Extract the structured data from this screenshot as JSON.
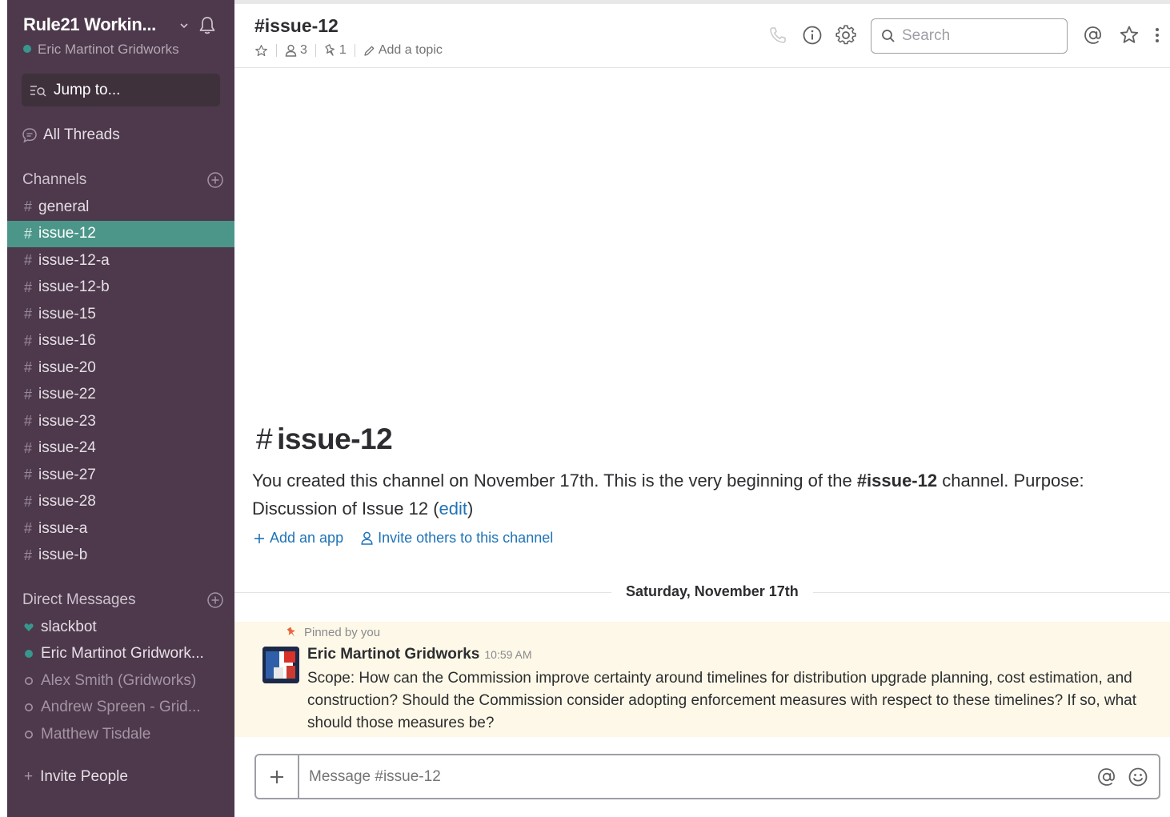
{
  "window": {
    "accent": "#4c9689",
    "sidebar_bg": "#4d394b"
  },
  "sidebar": {
    "team_name": "Rule21 Workin...",
    "current_user": "Eric Martinot Gridworks",
    "jump_to": "Jump to...",
    "all_threads": "All Threads",
    "channels_heading": "Channels",
    "channels": [
      {
        "name": "general",
        "active": false
      },
      {
        "name": "issue-12",
        "active": true
      },
      {
        "name": "issue-12-a",
        "active": false
      },
      {
        "name": "issue-12-b",
        "active": false
      },
      {
        "name": "issue-15",
        "active": false
      },
      {
        "name": "issue-16",
        "active": false
      },
      {
        "name": "issue-20",
        "active": false
      },
      {
        "name": "issue-22",
        "active": false
      },
      {
        "name": "issue-23",
        "active": false
      },
      {
        "name": "issue-24",
        "active": false
      },
      {
        "name": "issue-27",
        "active": false
      },
      {
        "name": "issue-28",
        "active": false
      },
      {
        "name": "issue-a",
        "active": false
      },
      {
        "name": "issue-b",
        "active": false
      }
    ],
    "dm_heading": "Direct Messages",
    "direct_messages": [
      {
        "name": "slackbot",
        "status": "heart"
      },
      {
        "name": "Eric Martinot Gridwork...",
        "status": "online"
      },
      {
        "name": "Alex Smith (Gridworks)",
        "status": "away"
      },
      {
        "name": "Andrew Spreen - Grid...",
        "status": "away"
      },
      {
        "name": "Matthew Tisdale",
        "status": "away"
      }
    ],
    "invite_people": "Invite People"
  },
  "header": {
    "channel_title": "#issue-12",
    "member_count": "3",
    "pinned_count": "1",
    "add_topic": "Add a topic",
    "search_placeholder": "Search"
  },
  "intro": {
    "hash": "#",
    "title": "issue-12",
    "text_before": "You created this channel on November 17th. This is the very beginning of the ",
    "channel_ref": "#issue-12",
    "text_after": " channel. Purpose: Discussion of Issue 12 (",
    "edit_link": "edit",
    "text_close": ")",
    "add_app": "Add an app",
    "invite_others": "Invite others to this channel"
  },
  "day_divider": "Saturday, November 17th",
  "message": {
    "pinned_label": "Pinned by you",
    "author": "Eric Martinot Gridworks",
    "time": "10:59 AM",
    "body": "Scope:  How can the Commission improve certainty around timelines for distribution upgrade planning, cost estimation, and construction? Should the Commission consider adopting enforcement measures with respect to these timelines? If so, what should those measures be?"
  },
  "composer": {
    "placeholder": "Message #issue-12"
  }
}
